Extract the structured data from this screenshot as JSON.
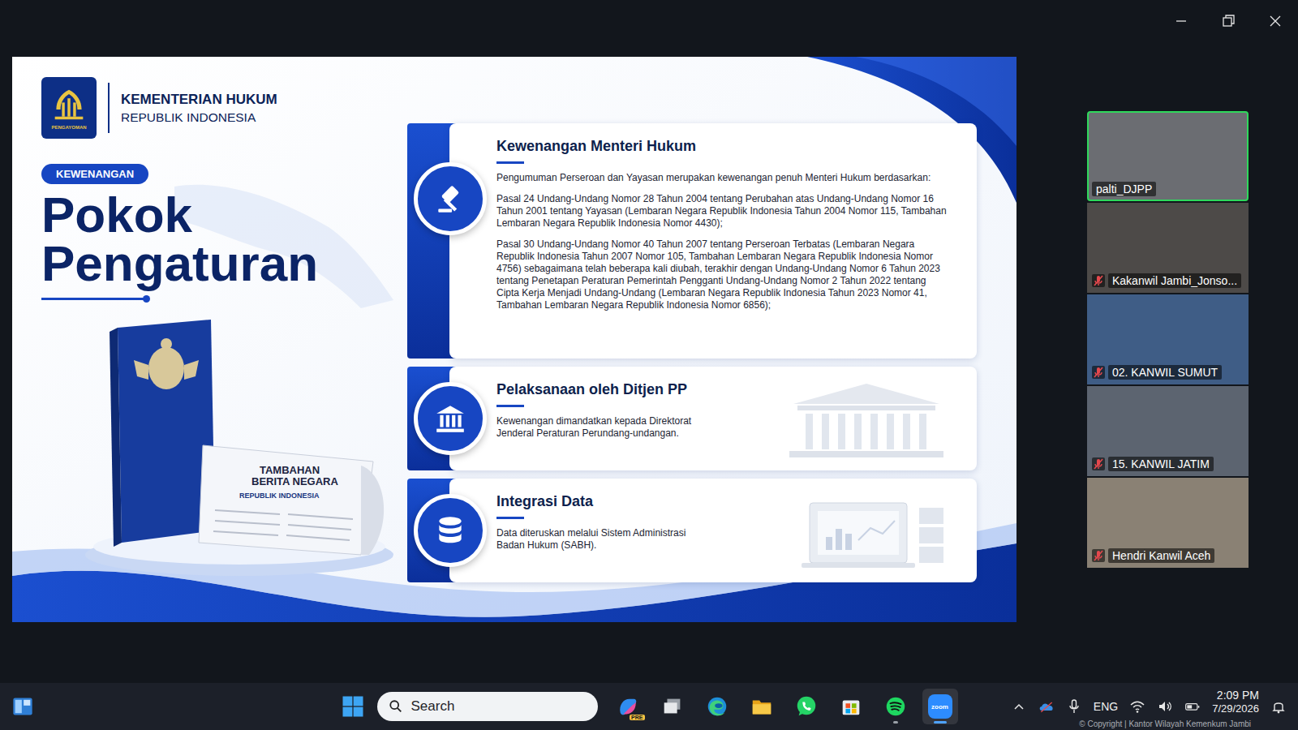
{
  "slide": {
    "org": {
      "line1": "KEMENTERIAN HUKUM",
      "line2": "REPUBLIK INDONESIA",
      "logo_caption": "PENGAYOMAN"
    },
    "badge": "KEWENANGAN",
    "title": [
      "Pokok",
      "Pengaturan"
    ],
    "illustration": {
      "paper_title": [
        "TAMBAHAN",
        "BERITA NEGARA"
      ],
      "paper_subtitle": "REPUBLIK INDONESIA"
    },
    "cards": [
      {
        "title": "Kewenangan Menteri Hukum",
        "paragraphs": [
          "Pengumuman Perseroan dan Yayasan merupakan kewenangan penuh Menteri Hukum berdasarkan:",
          "Pasal 24 Undang-Undang Nomor 28 Tahun 2004 tentang Perubahan atas Undang-Undang Nomor 16 Tahun 2001 tentang Yayasan (Lembaran Negara Republik Indonesia Tahun 2004 Nomor 115, Tambahan Lembaran Negara Republik Indonesia Nomor 4430);",
          "Pasal 30 Undang-Undang Nomor 40 Tahun 2007 tentang Perseroan Terbatas (Lembaran Negara Republik Indonesia Tahun 2007 Nomor 105, Tambahan Lembaran Negara Republik Indonesia Nomor 4756) sebagaimana telah beberapa kali diubah, terakhir dengan Undang-Undang Nomor 6 Tahun 2023 tentang Penetapan Peraturan Pemerintah Pengganti Undang-Undang Nomor 2 Tahun 2022 tentang Cipta Kerja Menjadi Undang-Undang (Lembaran Negara Republik Indonesia Tahun 2023 Nomor 41, Tambahan Lembaran Negara Republik Indonesia Nomor 6856);"
        ]
      },
      {
        "title": "Pelaksanaan oleh Ditjen PP",
        "paragraphs": [
          "Kewenangan dimandatkan kepada Direktorat Jenderal Peraturan Perundang-undangan."
        ]
      },
      {
        "title": "Integrasi Data",
        "paragraphs": [
          "Data diteruskan melalui Sistem Administrasi Badan Hukum (SABH)."
        ]
      }
    ]
  },
  "participants": [
    {
      "name": "palti_DJPP",
      "muted": false,
      "speaking": true
    },
    {
      "name": "Kakanwil Jambi_Jonso...",
      "muted": true,
      "speaking": false
    },
    {
      "name": "02. KANWIL SUMUT",
      "muted": true,
      "speaking": false
    },
    {
      "name": "15. KANWIL JATIM",
      "muted": true,
      "speaking": false
    },
    {
      "name": "Hendri Kanwil Aceh",
      "muted": true,
      "speaking": false
    }
  ],
  "taskbar": {
    "search": {
      "placeholder": "Search"
    },
    "apps": [
      {
        "kind": "copilot",
        "badge": "PRE",
        "running": false,
        "active": false
      },
      {
        "kind": "taskview",
        "running": false,
        "active": false
      },
      {
        "kind": "edge",
        "running": false,
        "active": false
      },
      {
        "kind": "explorer",
        "running": false,
        "active": false
      },
      {
        "kind": "whatsapp",
        "running": false,
        "active": false
      },
      {
        "kind": "store",
        "running": false,
        "active": false
      },
      {
        "kind": "spotify",
        "running": true,
        "active": false
      },
      {
        "kind": "zoom",
        "label": "zoom",
        "running": true,
        "active": true
      }
    ],
    "language": "ENG",
    "time": "2:09 PM",
    "date": "7/29/2026",
    "watermark": "© Copyright | Kantor Wilayah Kemenkum Jambi"
  }
}
